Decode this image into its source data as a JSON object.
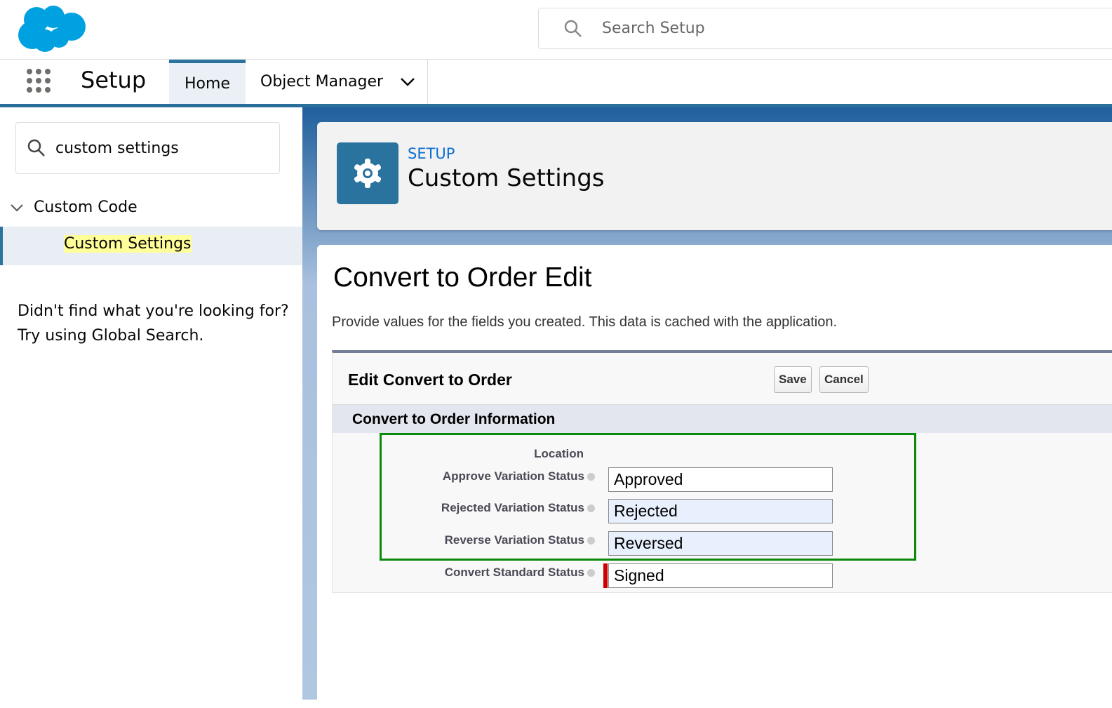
{
  "header": {
    "search_placeholder": "Search Setup",
    "app_name": "Setup",
    "tabs": [
      {
        "label": "Home"
      },
      {
        "label": "Object Manager"
      }
    ]
  },
  "sidebar": {
    "quick_find": "custom settings",
    "group": "Custom Code",
    "selected_item": "Custom Settings",
    "hint_line1": "Didn't find what you're looking for?",
    "hint_line2": "Try using Global Search."
  },
  "page_header": {
    "breadcrumb": "SETUP",
    "title": "Custom Settings"
  },
  "main": {
    "title": "Convert to Order Edit",
    "description": "Provide values for the fields you created. This data is cached with the application.",
    "block_title": "Edit Convert to Order",
    "save_label": "Save",
    "cancel_label": "Cancel",
    "section_title": "Convert to Order Information",
    "location_label": "Location",
    "fields": [
      {
        "label": "Approve Variation Status",
        "value": "Approved"
      },
      {
        "label": "Rejected Variation Status",
        "value": "Rejected"
      },
      {
        "label": "Reverse Variation Status",
        "value": "Reversed"
      },
      {
        "label": "Convert Standard Status",
        "value": "Signed"
      }
    ]
  },
  "colors": {
    "brand": "#00a1e0",
    "accent": "#2a739e",
    "highlight_box": "#0a8a0a",
    "required": "#cc0000"
  }
}
